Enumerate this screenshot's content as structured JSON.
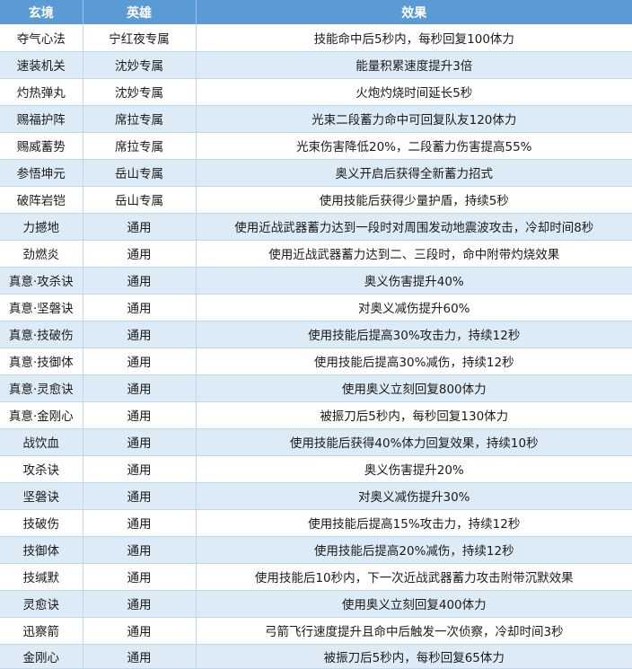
{
  "header": {
    "col_realm": "玄境",
    "col_hero": "英雄",
    "col_effect": "效果"
  },
  "rows": [
    {
      "realm": "夺气心法",
      "hero": "宁红夜专属",
      "effect": "技能命中后5秒内，每秒回复100体力"
    },
    {
      "realm": "速装机关",
      "hero": "沈妙专属",
      "effect": "能量积累速度提升3倍"
    },
    {
      "realm": "灼热弹丸",
      "hero": "沈妙专属",
      "effect": "火炮灼烧时间延长5秒"
    },
    {
      "realm": "赐福护阵",
      "hero": "席拉专属",
      "effect": "光束二段蓄力命中可回复队友120体力"
    },
    {
      "realm": "赐威蓄势",
      "hero": "席拉专属",
      "effect": "光束伤害降低20%，二段蓄力伤害提高55%"
    },
    {
      "realm": "参悟坤元",
      "hero": "岳山专属",
      "effect": "奥义开启后获得全新蓄力招式"
    },
    {
      "realm": "破阵岩铠",
      "hero": "岳山专属",
      "effect": "使用技能后获得少量护盾，持续5秒"
    },
    {
      "realm": "力撼地",
      "hero": "通用",
      "effect": "使用近战武器蓄力达到一段时对周围发动地震波攻击，冷却时间8秒"
    },
    {
      "realm": "劲燃炎",
      "hero": "通用",
      "effect": "使用近战武器蓄力达到二、三段时，命中附带灼烧效果"
    },
    {
      "realm": "真意·攻杀诀",
      "hero": "通用",
      "effect": "奥义伤害提升40%"
    },
    {
      "realm": "真意·坚磐诀",
      "hero": "通用",
      "effect": "对奥义减伤提升60%"
    },
    {
      "realm": "真意·技破伤",
      "hero": "通用",
      "effect": "使用技能后提高30%攻击力，持续12秒"
    },
    {
      "realm": "真意·技御体",
      "hero": "通用",
      "effect": "使用技能后提高30%减伤，持续12秒"
    },
    {
      "realm": "真意·灵愈诀",
      "hero": "通用",
      "effect": "使用奥义立刻回复800体力"
    },
    {
      "realm": "真意·金刚心",
      "hero": "通用",
      "effect": "被振刀后5秒内，每秒回复130体力"
    },
    {
      "realm": "战饮血",
      "hero": "通用",
      "effect": "使用技能后获得40%体力回复效果，持续10秒"
    },
    {
      "realm": "攻杀诀",
      "hero": "通用",
      "effect": "奥义伤害提升20%"
    },
    {
      "realm": "坚磐诀",
      "hero": "通用",
      "effect": "对奥义减伤提升30%"
    },
    {
      "realm": "技破伤",
      "hero": "通用",
      "effect": "使用技能后提高15%攻击力，持续12秒"
    },
    {
      "realm": "技御体",
      "hero": "通用",
      "effect": "使用技能后提高20%减伤，持续12秒"
    },
    {
      "realm": "技缄默",
      "hero": "通用",
      "effect": "使用技能后10秒内，下一次近战武器蓄力攻击附带沉默效果"
    },
    {
      "realm": "灵愈诀",
      "hero": "通用",
      "effect": "使用奥义立刻回复400体力"
    },
    {
      "realm": "迅察箭",
      "hero": "通用",
      "effect": "弓箭飞行速度提升且命中后触发一次侦察，冷却时间3秒"
    },
    {
      "realm": "金刚心",
      "hero": "通用",
      "effect": "被振刀后5秒内，每秒回复65体力"
    }
  ]
}
